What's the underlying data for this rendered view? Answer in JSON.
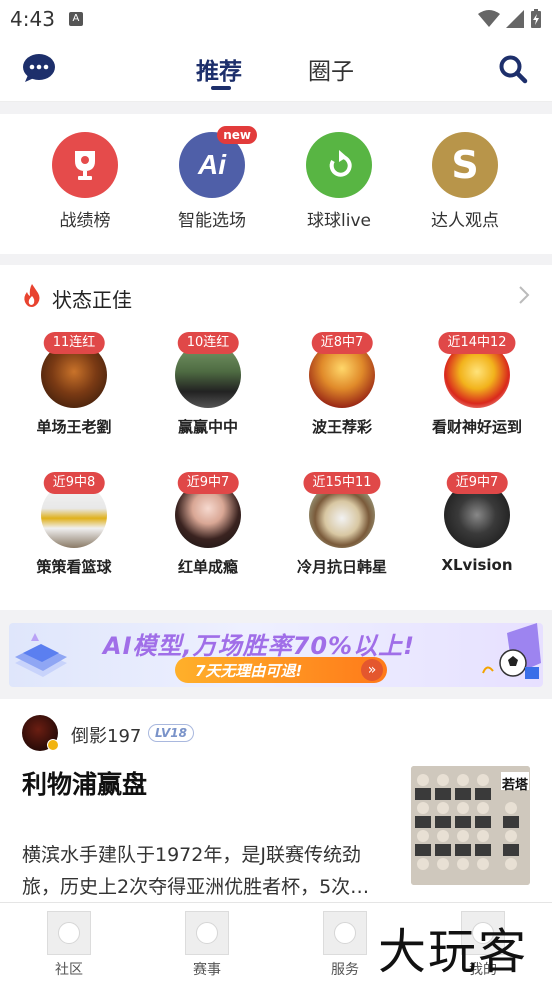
{
  "status_bar": {
    "time": "4:43",
    "notif_icon": "A"
  },
  "header": {
    "tabs": [
      {
        "label": "推荐",
        "active": true
      },
      {
        "label": "圈子",
        "active": false
      }
    ],
    "left_icon": "chat-bubble-icon",
    "right_icon": "search-icon"
  },
  "quick_entries": [
    {
      "label": "战绩榜",
      "icon": "trophy-icon",
      "color": "#e54b4b"
    },
    {
      "label": "智能选场",
      "icon": "ai-icon",
      "color": "#4f5fa8",
      "badge": "new"
    },
    {
      "label": "球球live",
      "icon": "refresh-arrow-icon",
      "color": "#58b543"
    },
    {
      "label": "达人观点",
      "icon": "s-coin-icon",
      "color": "#b8954a"
    }
  ],
  "hot_section": {
    "title": "状态正佳",
    "experts": [
      {
        "badge": "11连红",
        "name": "单场王老劉"
      },
      {
        "badge": "10连红",
        "name": "赢赢中中"
      },
      {
        "badge": "近8中7",
        "name": "波王荐彩"
      },
      {
        "badge": "近14中12",
        "name": "看财神好运到"
      },
      {
        "badge": "近9中8",
        "name": "策策看篮球"
      },
      {
        "badge": "近9中7",
        "name": "红单成瘾"
      },
      {
        "badge": "近15中11",
        "name": "冷月抗日韩星"
      },
      {
        "badge": "近9中7",
        "name": "XLvision"
      }
    ]
  },
  "banner": {
    "title": "AI模型,万场胜率70%以上!",
    "subtitle": "7天无理由可退!",
    "arrow": "»"
  },
  "article": {
    "author": "倒影197",
    "level": "LV18",
    "title": "利物浦赢盘",
    "body": "横滨水手建队于1972年，是J联赛传统劲旅，历史上2次夺得亚洲优胜者杯，5次…",
    "thumb_text": "若塔"
  },
  "bottom_nav": [
    {
      "label": "社区"
    },
    {
      "label": "赛事"
    },
    {
      "label": "服务"
    },
    {
      "label": "我的"
    }
  ],
  "watermark": "大玩客"
}
